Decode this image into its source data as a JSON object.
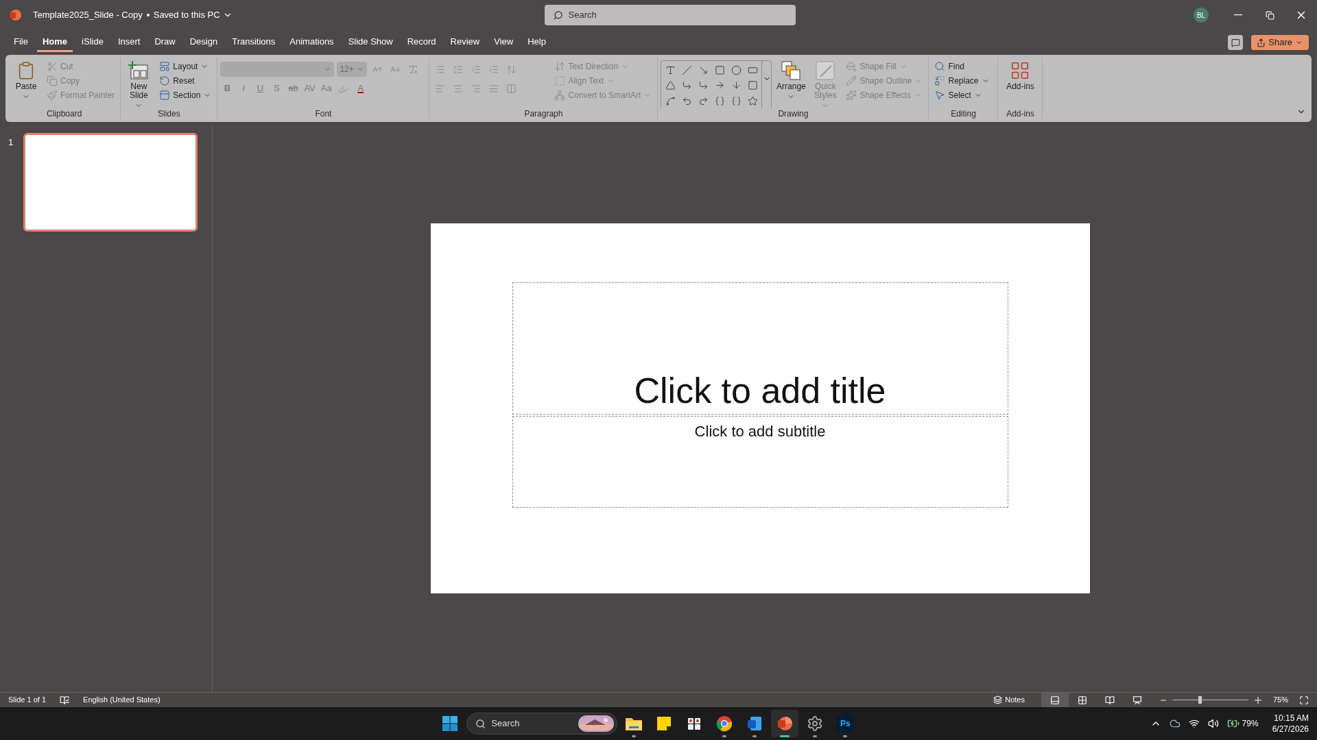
{
  "title_bar": {
    "document_title": "Template2025_Slide - Copy",
    "save_status": "Saved to this PC",
    "search": {
      "placeholder": "Search"
    },
    "account_initials": "BL"
  },
  "menu_tabs": [
    {
      "label": "File",
      "selected": false
    },
    {
      "label": "Home",
      "selected": true
    },
    {
      "label": "iSlide",
      "selected": false
    },
    {
      "label": "Insert",
      "selected": false
    },
    {
      "label": "Draw",
      "selected": false
    },
    {
      "label": "Design",
      "selected": false
    },
    {
      "label": "Transitions",
      "selected": false
    },
    {
      "label": "Animations",
      "selected": false
    },
    {
      "label": "Slide Show",
      "selected": false
    },
    {
      "label": "Record",
      "selected": false
    },
    {
      "label": "Review",
      "selected": false
    },
    {
      "label": "View",
      "selected": false
    },
    {
      "label": "Help",
      "selected": false
    }
  ],
  "share_button": "Share",
  "ribbon": {
    "groups": [
      {
        "kind": "clipboard",
        "label": "Clipboard",
        "large": [
          {
            "label": "Paste",
            "disabled": false
          }
        ],
        "small": [
          {
            "label": "Cut",
            "disabled": true
          },
          {
            "label": "Copy",
            "disabled": true
          },
          {
            "label": "Format Painter",
            "disabled": true
          }
        ]
      },
      {
        "kind": "slides",
        "label": "Slides",
        "large": [
          {
            "label": "New Slide",
            "disabled": false
          }
        ],
        "small": [
          {
            "label": "Layout",
            "disabled": false
          },
          {
            "label": "Reset",
            "disabled": false
          },
          {
            "label": "Section",
            "disabled": false
          }
        ]
      },
      {
        "kind": "font",
        "label": "Font",
        "font_size": "12+",
        "disabled": true,
        "format_buttons": [
          {
            "label": "B",
            "kind": "bold"
          },
          {
            "label": "I",
            "kind": "italic"
          },
          {
            "label": "U",
            "kind": "underline"
          },
          {
            "label": "S",
            "kind": "shadow"
          },
          {
            "label": "ab",
            "kind": "strike"
          },
          {
            "label": "AV",
            "kind": "spacing"
          },
          {
            "label": "Aa",
            "kind": "case"
          },
          {
            "label": "A",
            "kind": "color"
          }
        ]
      },
      {
        "kind": "paragraph",
        "label": "Paragraph",
        "disabled": true,
        "small": [
          {
            "label": "Text Direction",
            "disabled": true
          },
          {
            "label": "Align Text",
            "disabled": true
          },
          {
            "label": "Convert to SmartArt",
            "disabled": true
          }
        ]
      },
      {
        "kind": "drawing",
        "label": "Drawing",
        "large": [
          {
            "label": "Arrange",
            "disabled": false
          },
          {
            "label": "Quick Styles",
            "disabled": true
          }
        ],
        "small": [
          {
            "label": "Shape Fill",
            "disabled": true
          },
          {
            "label": "Shape Outline",
            "disabled": true
          },
          {
            "label": "Shape Effects",
            "disabled": true
          }
        ]
      },
      {
        "kind": "editing",
        "label": "Editing",
        "small": [
          {
            "label": "Find",
            "disabled": false
          },
          {
            "label": "Replace",
            "disabled": false
          },
          {
            "label": "Select",
            "disabled": false
          }
        ]
      },
      {
        "kind": "addins",
        "label": "Add-ins",
        "large": [
          {
            "label": "Add-ins",
            "disabled": false
          }
        ]
      }
    ]
  },
  "slide_panel": {
    "thumbnails": [
      {
        "number": "1",
        "selected": true
      }
    ]
  },
  "slide": {
    "title_placeholder": "Click to add title",
    "subtitle_placeholder": "Click to add subtitle"
  },
  "status_bar": {
    "slide_info": "Slide 1 of 1",
    "language": "English (United States)",
    "notes_button": "Notes",
    "views": [
      {
        "kind": "normal",
        "selected": true
      },
      {
        "kind": "sorter",
        "selected": false
      },
      {
        "kind": "reading",
        "selected": false
      },
      {
        "kind": "slideshow",
        "selected": false
      }
    ],
    "zoom": {
      "level": 0.35,
      "reading": "75%"
    }
  },
  "taskbar": {
    "search": {
      "placeholder": "Search"
    },
    "apps": [
      {
        "kind": "explorer",
        "running": true,
        "active": false
      },
      {
        "kind": "notes",
        "running": false,
        "active": false
      },
      {
        "kind": "tool",
        "running": false,
        "active": false
      },
      {
        "kind": "chrome",
        "running": true,
        "active": false
      },
      {
        "kind": "word",
        "running": true,
        "active": false
      },
      {
        "kind": "powerpoint",
        "running": true,
        "active": true
      },
      {
        "kind": "settings",
        "running": true,
        "active": false
      },
      {
        "kind": "photoshop",
        "label": "Ps",
        "running": true,
        "active": false
      }
    ],
    "battery": "79%",
    "time": "10:15 AM",
    "date": "6/27/2026"
  }
}
